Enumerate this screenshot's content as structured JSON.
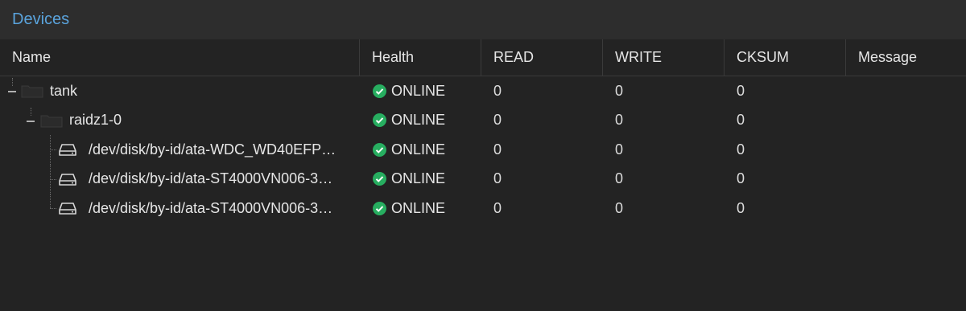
{
  "panel": {
    "title": "Devices"
  },
  "columns": {
    "name": "Name",
    "health": "Health",
    "read": "READ",
    "write": "WRITE",
    "cksum": "CKSUM",
    "message": "Message"
  },
  "rows": [
    {
      "name": "tank",
      "health": "ONLINE",
      "read": "0",
      "write": "0",
      "cksum": "0",
      "message": "",
      "icon": "folder-icon",
      "expanded": true
    },
    {
      "name": "raidz1-0",
      "health": "ONLINE",
      "read": "0",
      "write": "0",
      "cksum": "0",
      "message": "",
      "icon": "folder-icon",
      "expanded": true
    },
    {
      "name": "/dev/disk/by-id/ata-WDC_WD40EFP…",
      "health": "ONLINE",
      "read": "0",
      "write": "0",
      "cksum": "0",
      "message": "",
      "icon": "hard-drive-icon"
    },
    {
      "name": "/dev/disk/by-id/ata-ST4000VN006-3…",
      "health": "ONLINE",
      "read": "0",
      "write": "0",
      "cksum": "0",
      "message": "",
      "icon": "hard-drive-icon"
    },
    {
      "name": "/dev/disk/by-id/ata-ST4000VN006-3…",
      "health": "ONLINE",
      "read": "0",
      "write": "0",
      "cksum": "0",
      "message": "",
      "icon": "hard-drive-icon"
    }
  ],
  "colors": {
    "title": "#5aa3dc",
    "ok": "#27ae60",
    "background": "#232323"
  }
}
